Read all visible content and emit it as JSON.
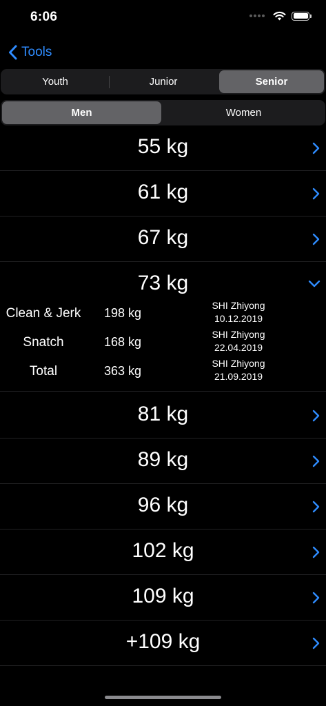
{
  "status_bar": {
    "time": "6:06",
    "icons": [
      "signal-dots-icon",
      "wifi-icon",
      "battery-icon"
    ]
  },
  "nav": {
    "back_label": "Tools",
    "back_icon": "chevron-left-icon"
  },
  "age_groups": {
    "options": [
      "Youth",
      "Junior",
      "Senior"
    ],
    "selected": "Senior"
  },
  "genders": {
    "options": [
      "Men",
      "Women"
    ],
    "selected": "Men"
  },
  "weight_classes": [
    {
      "label": "55 kg",
      "expanded": false
    },
    {
      "label": "61 kg",
      "expanded": false
    },
    {
      "label": "67 kg",
      "expanded": false
    },
    {
      "label": "73 kg",
      "expanded": true
    },
    {
      "label": "81 kg",
      "expanded": false
    },
    {
      "label": "89 kg",
      "expanded": false
    },
    {
      "label": "96 kg",
      "expanded": false
    },
    {
      "label": "102 kg",
      "expanded": false
    },
    {
      "label": "109 kg",
      "expanded": false
    },
    {
      "label": "+109 kg",
      "expanded": false
    }
  ],
  "expanded_records": [
    {
      "lift": "Clean & Jerk",
      "weight": "198 kg",
      "holder": "SHI Zhiyong",
      "date": "10.12.2019"
    },
    {
      "lift": "Snatch",
      "weight": "168 kg",
      "holder": "SHI Zhiyong",
      "date": "22.04.2019"
    },
    {
      "lift": "Total",
      "weight": "363 kg",
      "holder": "SHI Zhiyong",
      "date": "21.09.2019"
    }
  ],
  "colors": {
    "accent": "#2f8cff",
    "background": "#000000",
    "segment_bg": "#1c1c1e",
    "segment_selected": "#636366",
    "separator": "#222224"
  }
}
